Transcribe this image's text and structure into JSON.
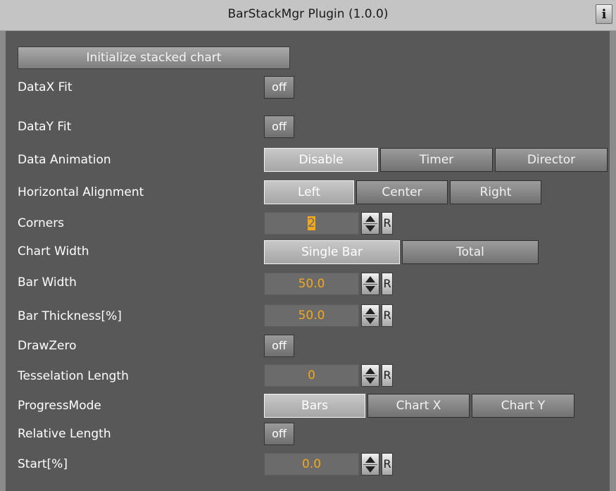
{
  "window": {
    "title": "BarStackMgr Plugin (1.0.0)",
    "info_label": "i"
  },
  "init_button": "Initialize stacked chart",
  "fields": {
    "datax_fit": {
      "label": "DataX Fit",
      "value": "off"
    },
    "datay_fit": {
      "label": "DataY Fit",
      "value": "off"
    },
    "data_animation": {
      "label": "Data Animation",
      "options": [
        "Disable",
        "Timer",
        "Director"
      ],
      "selected": "Disable"
    },
    "horizontal_alignment": {
      "label": "Horizontal Alignment",
      "options": [
        "Left",
        "Center",
        "Right"
      ],
      "selected": "Left"
    },
    "corners": {
      "label": "Corners",
      "value": "2"
    },
    "chart_width": {
      "label": "Chart Width",
      "options": [
        "Single Bar",
        "Total"
      ],
      "selected": "Single Bar"
    },
    "bar_width": {
      "label": "Bar Width",
      "value": "50.0"
    },
    "bar_thickness": {
      "label": "Bar Thickness[%]",
      "value": "50.0"
    },
    "draw_zero": {
      "label": "DrawZero",
      "value": "off"
    },
    "tesselation_length": {
      "label": "Tesselation Length",
      "value": "0"
    },
    "progress_mode": {
      "label": "ProgressMode",
      "options": [
        "Bars",
        "Chart X",
        "Chart Y"
      ],
      "selected": "Bars"
    },
    "relative_length": {
      "label": "Relative Length",
      "value": "off"
    },
    "start": {
      "label": "Start[%]",
      "value": "0.0"
    }
  },
  "reset_label": "R",
  "colors": {
    "panel": "#585858",
    "value_text": "#f2a81d",
    "titlebar": "#c4c4c4"
  }
}
